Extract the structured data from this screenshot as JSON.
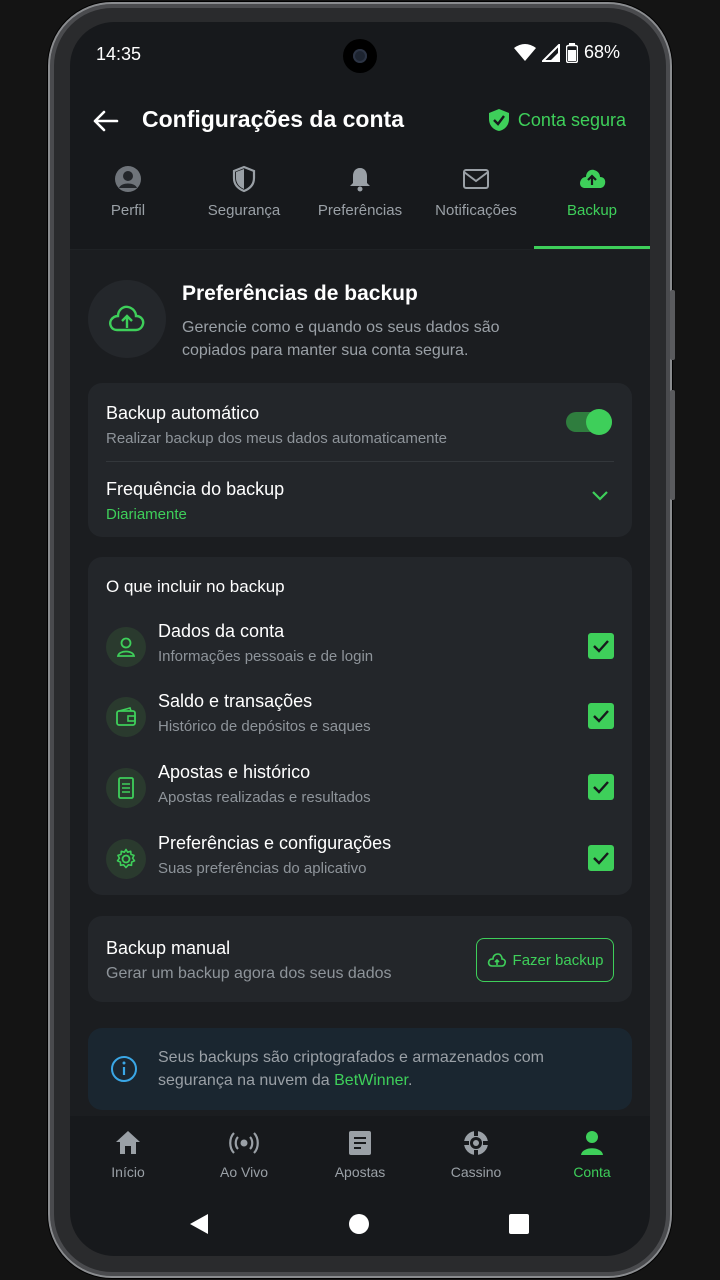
{
  "status": {
    "time": "14:35",
    "battery": "68%"
  },
  "appbar": {
    "title": "Configurações da conta",
    "secure_label": "Conta segura"
  },
  "tabs": [
    {
      "label": "Perfil",
      "icon": "user-icon",
      "active": false
    },
    {
      "label": "Segurança",
      "icon": "shield-icon",
      "active": false
    },
    {
      "label": "Preferências",
      "icon": "bell-icon",
      "active": false
    },
    {
      "label": "Notificações",
      "icon": "mail-icon",
      "active": false
    },
    {
      "label": "Backup",
      "icon": "cloud-upload-icon",
      "active": true
    }
  ],
  "hero": {
    "title": "Preferências de backup",
    "description": "Gerencie como e quando os seus dados são copiados para manter sua conta segura."
  },
  "auto_backup": {
    "title": "Backup automático",
    "subtitle": "Realizar backup dos meus dados automaticamente",
    "enabled": true
  },
  "frequency": {
    "title": "Frequência do backup",
    "value": "Diariamente"
  },
  "include": {
    "heading": "O que incluir no backup",
    "items": [
      {
        "title": "Dados da conta",
        "subtitle": "Informações pessoais e de login",
        "icon": "user-icon",
        "checked": true
      },
      {
        "title": "Saldo e transações",
        "subtitle": "Histórico de depósitos e saques",
        "icon": "wallet-icon",
        "checked": true
      },
      {
        "title": "Apostas e histórico",
        "subtitle": "Apostas realizadas e resultados",
        "icon": "document-icon",
        "checked": true
      },
      {
        "title": "Preferências e configurações",
        "subtitle": "Suas preferências do aplicativo",
        "icon": "gear-icon",
        "checked": true
      }
    ]
  },
  "manual": {
    "title": "Backup manual",
    "subtitle": "Gerar um backup agora dos seus dados",
    "button": "Fazer backup"
  },
  "info": {
    "text": "Seus backups são criptografados e armazenados com segurança na nuvem da ",
    "brand": "BetWinner",
    "suffix": "."
  },
  "bottom_nav": [
    {
      "label": "Início",
      "icon": "home-icon",
      "active": false
    },
    {
      "label": "Ao Vivo",
      "icon": "live-icon",
      "active": false
    },
    {
      "label": "Apostas",
      "icon": "bets-icon",
      "active": false
    },
    {
      "label": "Cassino",
      "icon": "casino-icon",
      "active": false
    },
    {
      "label": "Conta",
      "icon": "account-icon",
      "active": true
    }
  ],
  "colors": {
    "accent": "#3ecf5a",
    "background": "#17191c",
    "card": "#23262a"
  }
}
